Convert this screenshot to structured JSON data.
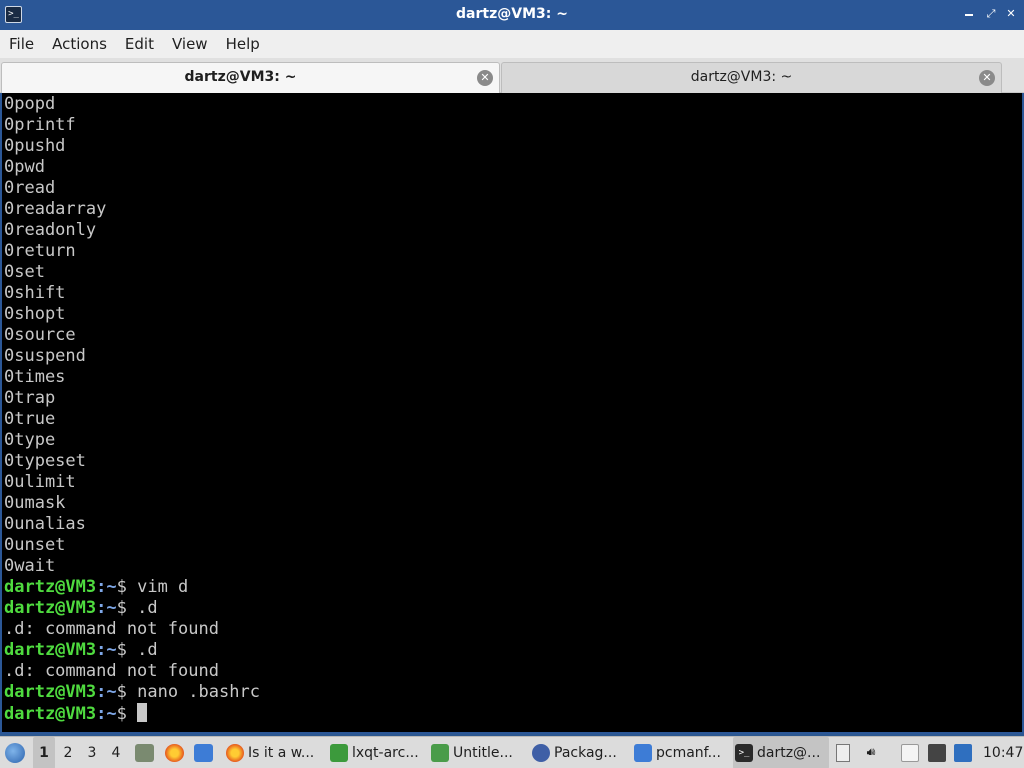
{
  "window": {
    "title": "dartz@VM3: ~"
  },
  "menu": [
    "File",
    "Actions",
    "Edit",
    "View",
    "Help"
  ],
  "tabs": [
    {
      "label": "dartz@VM3: ~",
      "active": true
    },
    {
      "label": "dartz@VM3: ~",
      "active": false
    }
  ],
  "terminal": {
    "output_lines": [
      "0popd",
      "0printf",
      "0pushd",
      "0pwd",
      "0read",
      "0readarray",
      "0readonly",
      "0return",
      "0set",
      "0shift",
      "0shopt",
      "0source",
      "0suspend",
      "0times",
      "0trap",
      "0true",
      "0type",
      "0typeset",
      "0ulimit",
      "0umask",
      "0unalias",
      "0unset",
      "0wait"
    ],
    "prompt": {
      "user_host": "dartz@VM3",
      "sep": ":",
      "path": "~",
      "dollar": "$ "
    },
    "session": [
      {
        "type": "cmd",
        "text": "vim d"
      },
      {
        "type": "cmd",
        "text": ".d"
      },
      {
        "type": "out",
        "text": ".d: command not found"
      },
      {
        "type": "cmd",
        "text": ".d"
      },
      {
        "type": "out",
        "text": ".d: command not found"
      },
      {
        "type": "cmd",
        "text": "nano .bashrc"
      },
      {
        "type": "cmd",
        "text": "",
        "cursor": true
      }
    ],
    "colors": {
      "background": "#000000",
      "text": "#c8c8c8",
      "user": "#4fdb3f",
      "path": "#7fa8e8"
    }
  },
  "taskbar": {
    "workspaces": [
      "1",
      "2",
      "3",
      "4"
    ],
    "active_workspace": "1",
    "tasks": [
      {
        "label": "Is it a w...",
        "icon": "firefox-icon"
      },
      {
        "label": "lxqt-arc...",
        "icon": "spreadsheet-icon"
      },
      {
        "label": "Untitle...",
        "icon": "document-icon"
      },
      {
        "label": "Packag...",
        "icon": "package-icon"
      },
      {
        "label": "pcmanf...",
        "icon": "folder-icon"
      },
      {
        "label": "dartz@...",
        "icon": "terminal-icon",
        "active": true
      }
    ],
    "clock": "10:47"
  }
}
